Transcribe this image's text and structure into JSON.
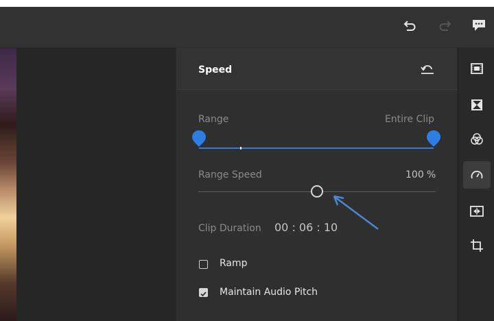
{
  "toolbar": {
    "undo_icon": "undo-icon",
    "redo_icon": "redo-icon",
    "comments_icon": "comments-icon"
  },
  "speed_panel": {
    "title": "Speed",
    "reset_icon": "reset-icon",
    "range_label": "Range",
    "range_value": "Entire Clip",
    "range_speed_label": "Range Speed",
    "range_speed_value": "100",
    "range_speed_unit": "%",
    "range_speed_slider_fraction": 0.5,
    "clip_duration_label": "Clip Duration",
    "clip_duration_value": "00 : 06 : 10",
    "ramp_label": "Ramp",
    "ramp_checked": false,
    "maintain_pitch_label": "Maintain Audio Pitch",
    "maintain_pitch_checked": true
  },
  "rail": {
    "items": [
      {
        "icon": "clip-icon",
        "active": false
      },
      {
        "icon": "transition-icon",
        "active": false
      },
      {
        "icon": "color-icon",
        "active": false
      },
      {
        "icon": "speed-icon",
        "active": true
      },
      {
        "icon": "audio-clip-icon",
        "active": false
      },
      {
        "icon": "crop-icon",
        "active": false
      }
    ]
  },
  "colors": {
    "accent": "#2d7de2",
    "arrow": "#4a88d0"
  }
}
